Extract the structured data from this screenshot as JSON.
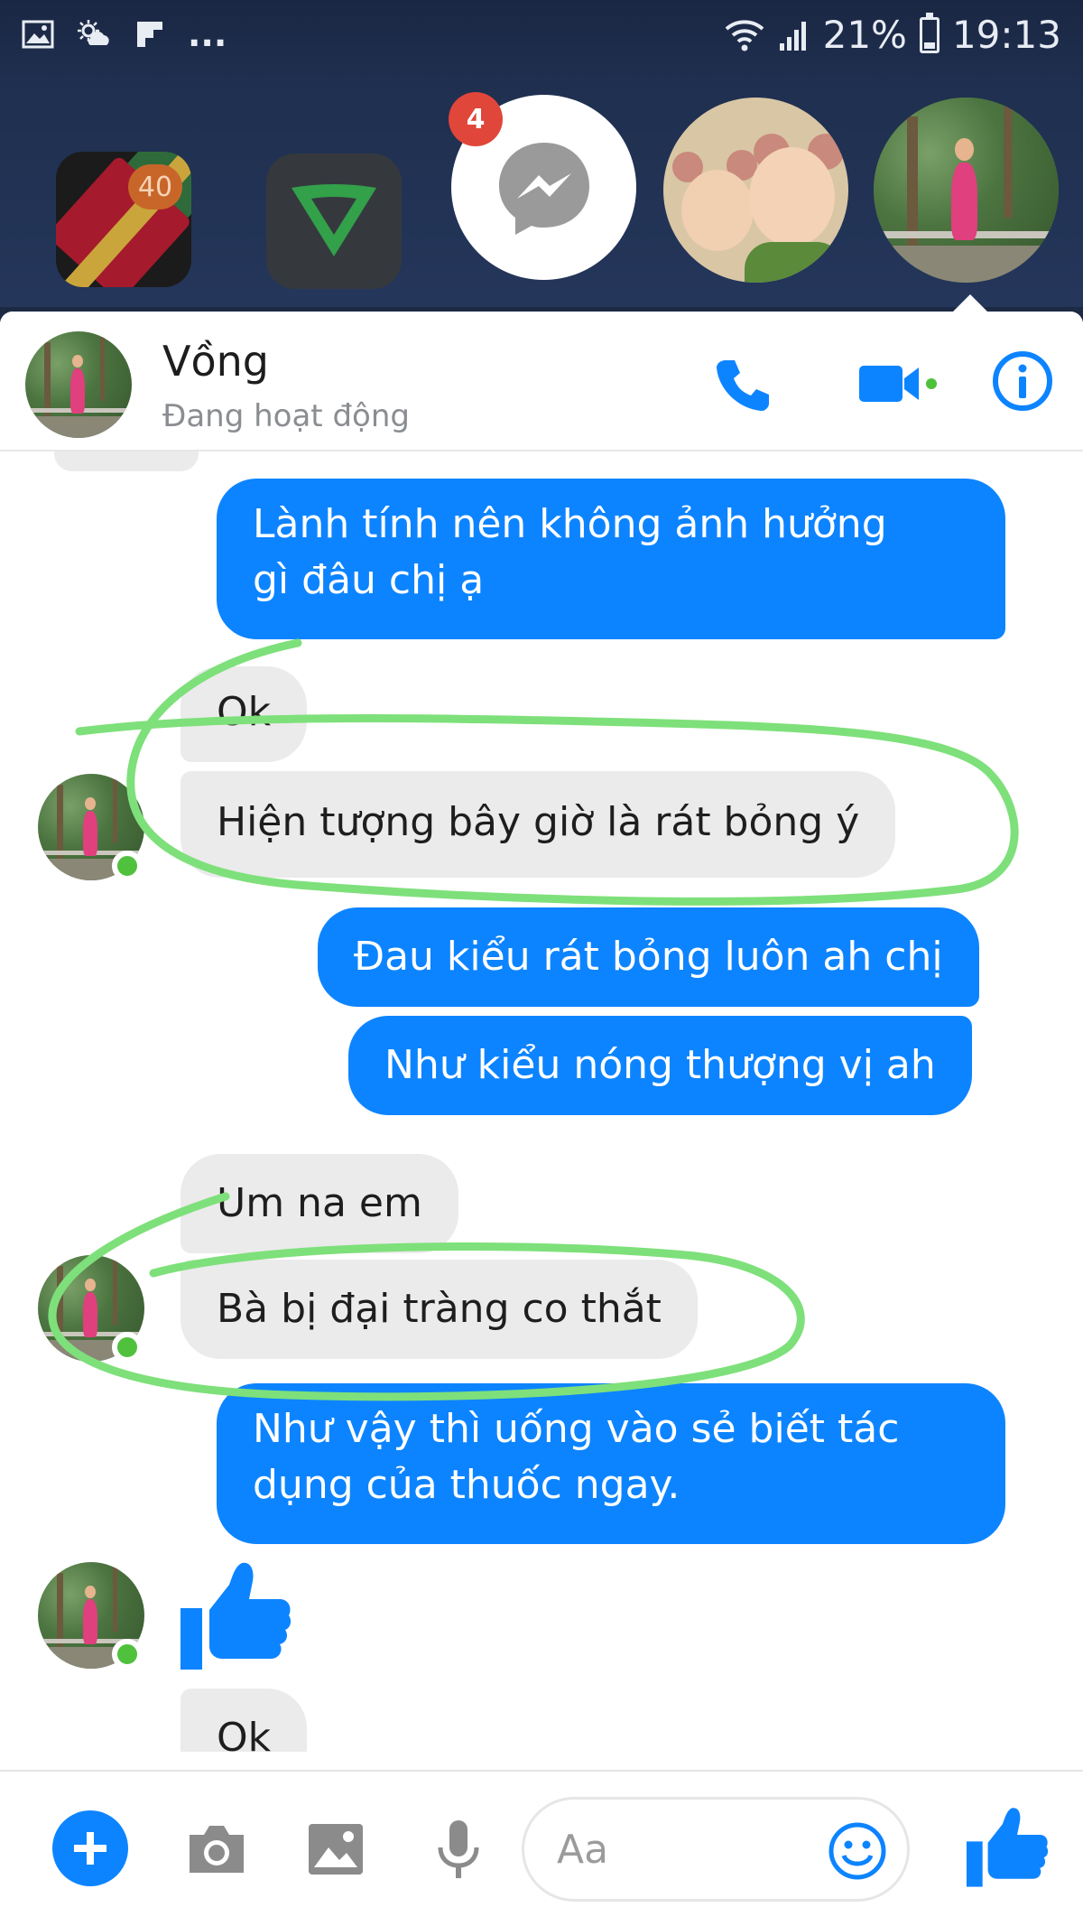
{
  "status_bar": {
    "left_icons": [
      "image-icon",
      "weather-icon",
      "flipboard-icon"
    ],
    "more": "...",
    "battery": "21%",
    "time": "19:13"
  },
  "chat_heads": {
    "maps_badge": "40",
    "messenger_badge": "4"
  },
  "header": {
    "name": "Vồng",
    "status": "Đang hoạt động"
  },
  "messages": [
    {
      "dir": "out",
      "lines": [
        "Lành tính nên không ảnh hưởng",
        "gì đâu chị ạ"
      ]
    },
    {
      "dir": "in",
      "text": "Ok"
    },
    {
      "dir": "in",
      "text": "Hiện tượng bây giờ là rát bỏng ý"
    },
    {
      "dir": "out",
      "text": "Đau kiểu rát bỏng luôn ah chị"
    },
    {
      "dir": "out",
      "text": "Như kiểu nóng thượng vị ah"
    },
    {
      "dir": "in",
      "text": "Um na em"
    },
    {
      "dir": "in",
      "text": "Bà bị đại tràng co thắt"
    },
    {
      "dir": "out",
      "lines": [
        "Như vậy thì uống vào sẻ biết tác",
        "dụng của thuốc ngay."
      ]
    },
    {
      "dir": "in",
      "text": "Ok"
    }
  ],
  "composer": {
    "placeholder": "Aa"
  },
  "colors": {
    "messenger_blue": "#0d84ff",
    "incoming_gray": "#ebebeb",
    "online_green": "#4fc13d",
    "highlight_green": "#7ee07a",
    "status_bar_bg": "#1a2743"
  }
}
